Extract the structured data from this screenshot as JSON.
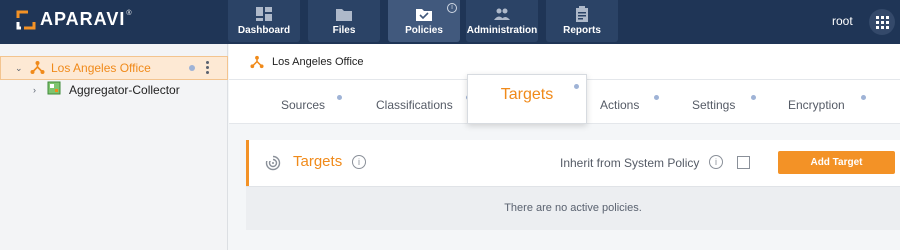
{
  "header": {
    "brand": "APARAVI",
    "brand_mark": "®",
    "nav": [
      {
        "label": "Dashboard",
        "icon": "dashboard-icon"
      },
      {
        "label": "Files",
        "icon": "folder-icon"
      },
      {
        "label": "Policies",
        "icon": "policies-folder-icon",
        "info": "i"
      },
      {
        "label": "Administration",
        "icon": "users-icon"
      },
      {
        "label": "Reports",
        "icon": "clipboard-icon"
      }
    ],
    "user": "root"
  },
  "sidebar": {
    "items": [
      {
        "label": "Los Angeles Office",
        "icon": "network-node-icon"
      },
      {
        "label": "Aggregator-Collector",
        "icon": "aggregator-icon"
      }
    ]
  },
  "breadcrumb": {
    "label": "Los Angeles Office"
  },
  "tabs": [
    "Sources",
    "Classifications",
    "Targets",
    "Actions",
    "Settings",
    "Encryption"
  ],
  "card": {
    "title": "Targets",
    "info": "i",
    "inherit_label": "Inherit from System Policy",
    "add_button": "Add Target"
  },
  "empty_message": "There are no active policies.",
  "colors": {
    "topbar": "#1f3556",
    "accent": "#f39226",
    "selected_row": "#fde9d4"
  }
}
